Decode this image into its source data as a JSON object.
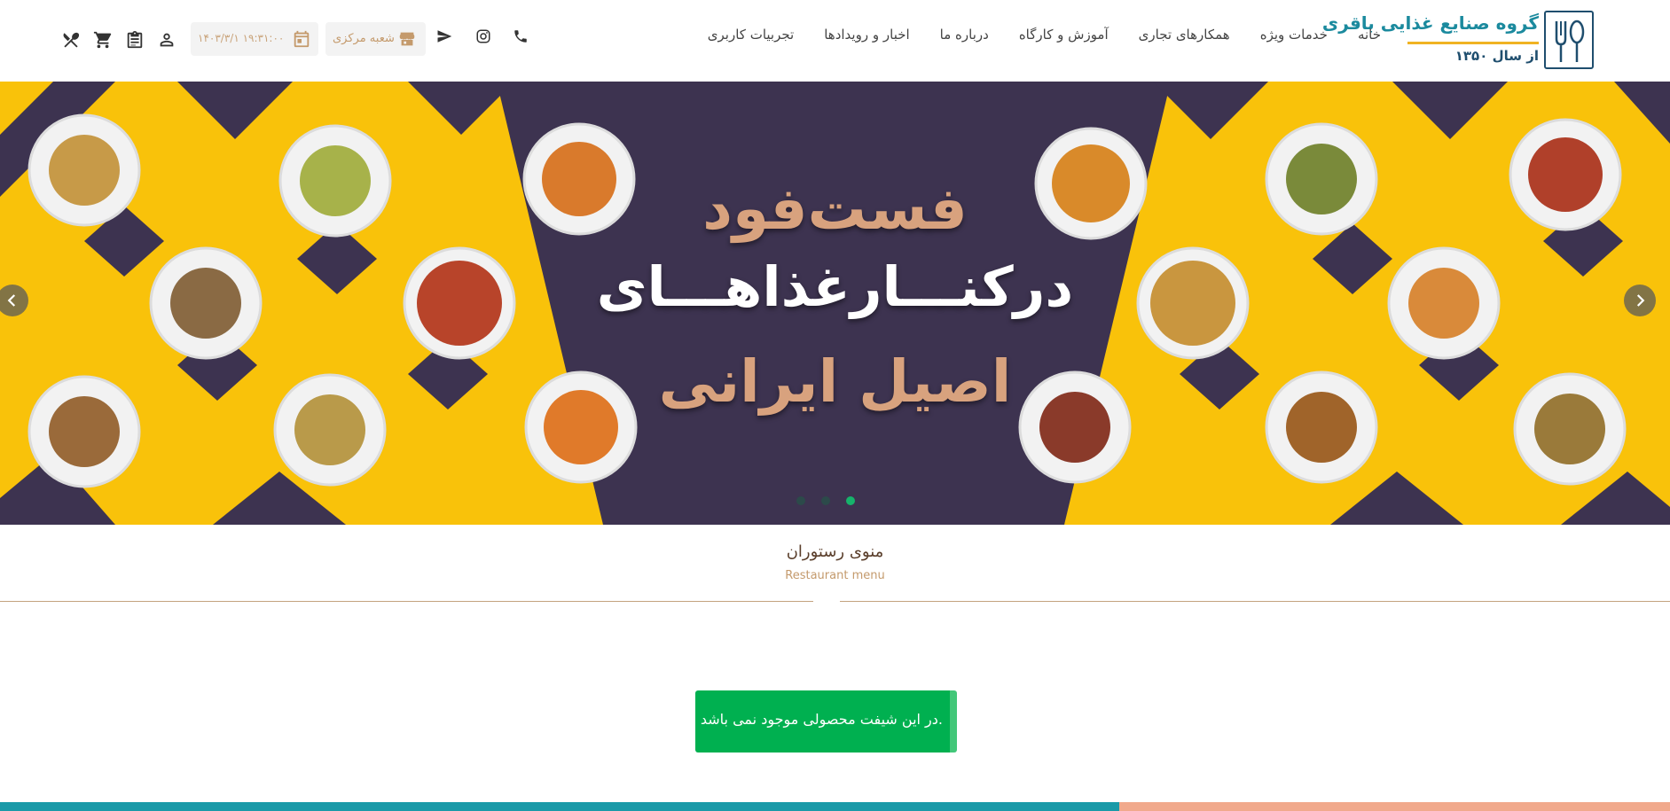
{
  "header": {
    "logo": {
      "title": "گروه صنایع غذایی باقری",
      "subtitle": "از سال ۱۳۵۰"
    },
    "nav": [
      {
        "label": "خانه"
      },
      {
        "label": "خدمات ویژه"
      },
      {
        "label": "همکارهای تجاری"
      },
      {
        "label": "آموزش و کارگاه"
      },
      {
        "label": "درباره ما"
      },
      {
        "label": "اخبار و رویدادها"
      },
      {
        "label": "تجربیات کاربری"
      }
    ],
    "tools": {
      "icons": [
        "restaurant-icon",
        "cart-icon",
        "clipboard-icon",
        "user-icon"
      ],
      "datetime": "۱۴۰۳/۳/۱ ۱۹:۳۱:۰۰",
      "branch": "شعبه مرکزی"
    },
    "social_icons": [
      "send-icon",
      "instagram-icon",
      "phone-icon"
    ]
  },
  "banner": {
    "line1": "فست‌فود",
    "line2": "درکنـــارغذاهـــای",
    "line3": "اصیل ایرانی",
    "slides_count": 3,
    "active_slide": 3,
    "colors": {
      "bg_yellow": "#f9c20a",
      "bg_purple": "#3d3350"
    }
  },
  "section": {
    "title": "منوی رستوران",
    "subtitle": "Restaurant menu",
    "notice": "در این شیفت محصولی موجود نمی باشد."
  },
  "colors": {
    "accent": "#c49a6c",
    "success": "#00b050",
    "teal": "#1a9aa8"
  }
}
